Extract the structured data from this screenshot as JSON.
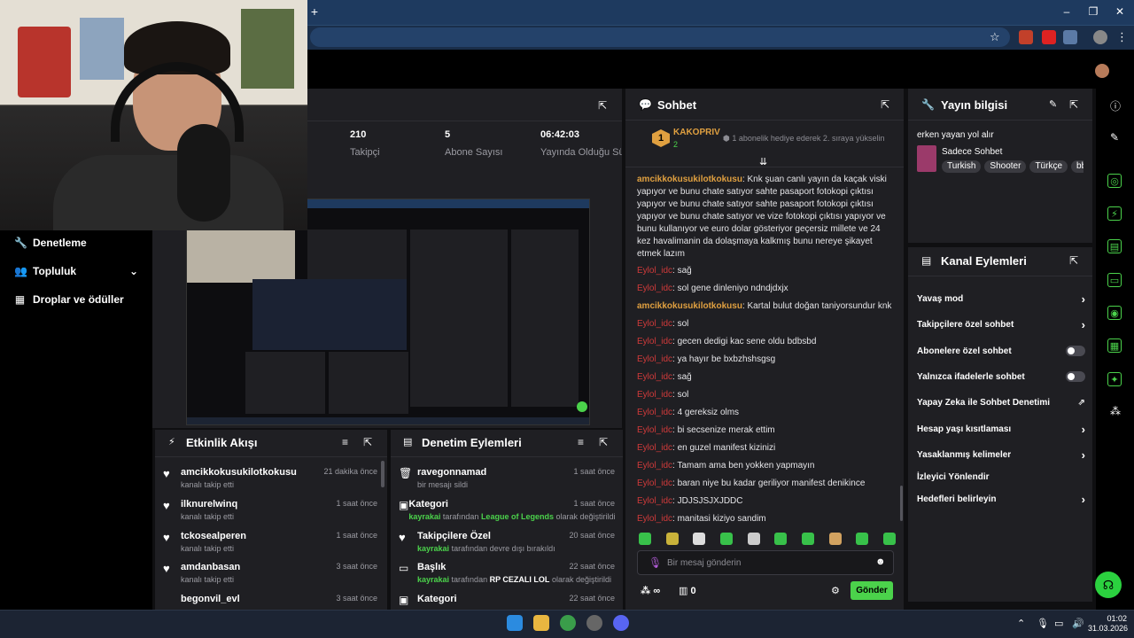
{
  "browser": {
    "new_tab": "+"
  },
  "nav": {
    "items": [
      {
        "label": "Denetleme",
        "icon": "wrench-icon"
      },
      {
        "label": "Topluluk",
        "icon": "people-icon"
      },
      {
        "label": "Droplar ve ödüller",
        "icon": "gift-icon"
      }
    ]
  },
  "stats": [
    {
      "value": "210",
      "label": "Takipçi"
    },
    {
      "value": "5",
      "label": "Abone Sayısı"
    },
    {
      "value": "06:42:03",
      "label": "Yayında Olduğu Süre"
    }
  ],
  "activity": {
    "title": "Etkinlik Akışı",
    "items": [
      {
        "name": "amcikkokusukilotkokusu",
        "sub": "kanalı takip etti",
        "time": "21 dakika önce"
      },
      {
        "name": "ilknurelwinq",
        "sub": "kanalı takip etti",
        "time": "1 saat önce"
      },
      {
        "name": "tckosealperen",
        "sub": "kanalı takip etti",
        "time": "1 saat önce"
      },
      {
        "name": "amdanbasan",
        "sub": "kanalı takip etti",
        "time": "3 saat önce"
      },
      {
        "name": "begonvil_evl",
        "sub": "",
        "time": "3 saat önce"
      }
    ]
  },
  "moderation": {
    "title": "Denetim Eylemleri",
    "items": [
      {
        "name": "ravegonnamad",
        "pre": "",
        "mid": "",
        "post": "bir mesajı sildi",
        "time": "1 saat önce"
      },
      {
        "name": "Kategori",
        "pre": "kayrakai",
        "mid": "League of Legends",
        "post": "olarak değiştirildi",
        "middle": " tarafından ",
        "time": "1 saat önce"
      },
      {
        "name": "Takipçilere Özel",
        "pre": "kayrakai",
        "mid": "",
        "post": "tarafından devre dışı bırakıldı",
        "time": "20 saat önce"
      },
      {
        "name": "Başlık",
        "pre": "kayrakai",
        "mid": "RP CEZALI LOL",
        "post": "olarak değiştirildi",
        "middle": " tarafından ",
        "time": "22 saat önce"
      },
      {
        "name": "Kategori",
        "pre": "",
        "mid": "",
        "post": "",
        "time": "22 saat önce"
      }
    ]
  },
  "chat": {
    "title": "Sohbet",
    "pinned": {
      "user": "KAKOPRIV",
      "badge": "1",
      "count": "2",
      "text": "1 abonelik hediye ederek 2. sıraya yükselin"
    },
    "messages": [
      {
        "user": "amcikkokusukilotkokusu",
        "color": "orange",
        "text": "Knk şuan canlı yayın da kaçak viski yapıyor ve bunu chate satıyor sahte pasaport fotokopi çıktısı yapıyor ve bunu chate satıyor sahte pasaport fotokopi çıktısı yapıyor ve bunu chate satıyor ve vize fotokopi çıktısı yapıyor ve bunu kullanıyor ve euro dolar gösteriyor geçersiz millete ve 24 kez havalimanin da dolaşmaya kalkmış bunu nereye şikayet etmek lazım"
      },
      {
        "user": "Eylol_idc",
        "color": "red",
        "text": "sağ"
      },
      {
        "user": "Eylol_idc",
        "color": "red",
        "text": "sol gene dinleniyo ndndjdxjx"
      },
      {
        "user": "amcikkokusukilotkokusu",
        "color": "orange",
        "text": "Kartal bulut doğan taniyorsundur knk"
      },
      {
        "user": "Eylol_idc",
        "color": "red",
        "text": "sol"
      },
      {
        "user": "Eylol_idc",
        "color": "red",
        "text": "gecen dedigi kac sene oldu bdbsbd"
      },
      {
        "user": "Eylol_idc",
        "color": "red",
        "text": "ya hayır be bxbzhshsgsg"
      },
      {
        "user": "Eylol_idc",
        "color": "red",
        "text": "sağ"
      },
      {
        "user": "Eylol_idc",
        "color": "red",
        "text": "sol"
      },
      {
        "user": "Eylol_idc",
        "color": "red",
        "text": "4 gereksiz olms"
      },
      {
        "user": "Eylol_idc",
        "color": "red",
        "text": "bi secsenize merak ettim"
      },
      {
        "user": "Eylol_idc",
        "color": "red",
        "text": "en guzel manifest kizinizi"
      },
      {
        "user": "Eylol_idc",
        "color": "red",
        "text": "Tamam ama ben yokken yapmayın"
      },
      {
        "user": "Eylol_idc",
        "color": "red",
        "text": "baran niye bu kadar geriliyor manifest denikince"
      },
      {
        "user": "Eylol_idc",
        "color": "red",
        "text": "JDJSJSJXJDDC"
      },
      {
        "user": "Eylol_idc",
        "color": "red",
        "text": "manitasi kiziyo sandim"
      }
    ],
    "input_placeholder": "Bir mesaj gönderin",
    "points": "∞",
    "gift_count": "0",
    "send_label": "Gönder"
  },
  "stream_info": {
    "title": "Yayın bilgisi",
    "stream_title": "erken yayan yol alır",
    "category": "Sadece Sohbet",
    "tags": [
      "Turkish",
      "Shooter",
      "Türkçe",
      "bb"
    ]
  },
  "channel_actions": {
    "title": "Kanal Eylemleri",
    "items": [
      {
        "label": "Yavaş mod",
        "control": "chevron"
      },
      {
        "label": "Takipçilere özel sohbet",
        "control": "chevron"
      },
      {
        "label": "Abonelere özel sohbet",
        "control": "toggle"
      },
      {
        "label": "Yalnızca ifadelerle sohbet",
        "control": "toggle"
      },
      {
        "label": "Yapay Zeka ile Sohbet Denetimi",
        "control": "external"
      },
      {
        "label": "Hesap yaşı kısıtlaması",
        "control": "chevron"
      },
      {
        "label": "Yasaklanmış kelimeler",
        "control": "chevron"
      },
      {
        "label": "İzleyici Yönlendir",
        "control": "none"
      },
      {
        "label": "Hedefleri belirleyin",
        "control": "chevron"
      }
    ]
  },
  "taskbar": {
    "time": "01:02",
    "date": "31.03.2026"
  },
  "colors": {
    "accent_green": "#4bd24b",
    "panel": "#1f1f23",
    "chat_user_orange": "#e0a040",
    "chat_user_red": "#d03a3a"
  }
}
